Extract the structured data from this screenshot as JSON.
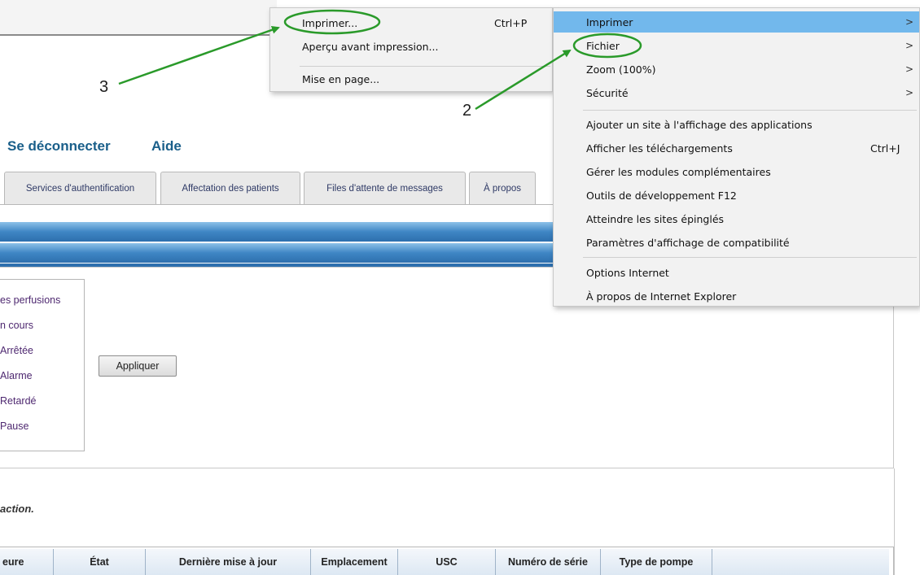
{
  "header": {
    "logout_link": "Se déconnecter",
    "help_link": "Aide"
  },
  "tabs": [
    "Services d'authentification",
    "Affectation des patients",
    "Files d'attente de messages",
    "À propos"
  ],
  "filters": {
    "items": [
      "es perfusions",
      "n cours",
      "​Arrêtée",
      "Alarme",
      "Retardé",
      "Pause"
    ],
    "apply_button": "Appliquer"
  },
  "instruction_text": "action.",
  "table": {
    "columns": [
      "eure",
      "État",
      "Dernière mise à jour",
      "Emplacement",
      "USC",
      "Numéro de série",
      "Type de pompe"
    ]
  },
  "print_submenu": {
    "items": [
      {
        "label": "Imprimer...",
        "shortcut": "Ctrl+P"
      },
      {
        "label": "Aperçu avant impression..."
      },
      {
        "label": "Mise en page..."
      }
    ]
  },
  "tools_menu": {
    "items": [
      {
        "label": "Imprimer",
        "has_submenu": true
      },
      {
        "label": "Fichier",
        "has_submenu": true
      },
      {
        "label": "Zoom (100%)",
        "has_submenu": true
      },
      {
        "label": "Sécurité",
        "has_submenu": true
      },
      {
        "label": "Ajouter un site à l'affichage des applications"
      },
      {
        "label": "Afficher les téléchargements",
        "shortcut": "Ctrl+J"
      },
      {
        "label": "Gérer les modules complémentaires"
      },
      {
        "label": "Outils de développement F12"
      },
      {
        "label": "Atteindre les sites épinglés"
      },
      {
        "label": "Paramètres d'affichage de compatibilité"
      },
      {
        "label": "Options Internet"
      },
      {
        "label": "À propos de Internet Explorer"
      }
    ],
    "highlight_color": "#72b8ec",
    "arrow_glyph": ">"
  },
  "callouts": {
    "step_3": "3",
    "step_2": "2",
    "arrow_color": "#2a9a2a"
  }
}
